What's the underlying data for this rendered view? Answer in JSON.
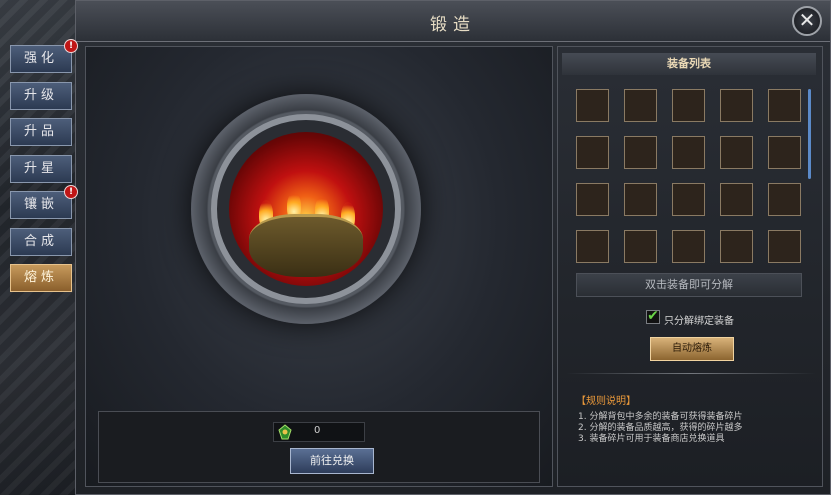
{
  "window": {
    "title": "锻造",
    "close_label": "✕"
  },
  "tabs": [
    {
      "label": "强化",
      "badge": "!"
    },
    {
      "label": "升级",
      "badge": ""
    },
    {
      "label": "升品",
      "badge": ""
    },
    {
      "label": "升星",
      "badge": ""
    },
    {
      "label": "镶嵌",
      "badge": "!"
    },
    {
      "label": "合成",
      "badge": ""
    },
    {
      "label": "熔炼",
      "badge": "",
      "active": true
    }
  ],
  "forge": {
    "fragment_count": "0",
    "exchange_button": "前往兑换"
  },
  "equipment": {
    "header": "装备列表",
    "slot_rows": 4,
    "slot_cols": 5,
    "hint": "双击装备即可分解",
    "bound_only_label": "只分解绑定装备",
    "bound_only_checked": true,
    "auto_button": "自动熔炼"
  },
  "rules": {
    "title": "【规则说明】",
    "items": [
      "1. 分解背包中多余的装备可获得装备碎片",
      "2. 分解的装备品质越高，获得的碎片越多",
      "3. 装备碎片可用于装备商店兑换道具"
    ]
  },
  "colors": {
    "active_tab": "#c79a5c",
    "tab": "#3d4c66",
    "badge": "#c01616",
    "check": "#69d447",
    "rules_title": "#e8983a"
  }
}
